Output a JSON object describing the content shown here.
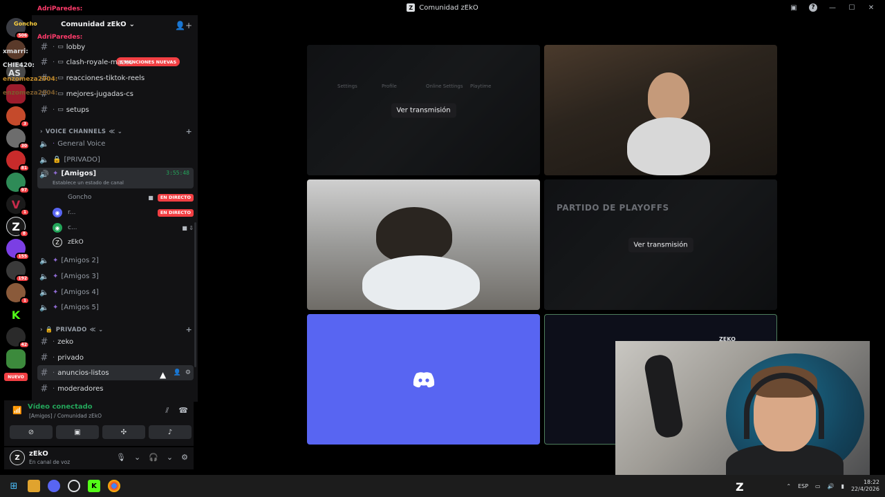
{
  "window": {
    "title": "Comunidad zEkO",
    "logo_letter": "Z"
  },
  "overlay_chat": [
    {
      "text": "AdriParedes:",
      "color": "#ff3b6b"
    },
    {
      "text": "Goncho",
      "color": "#ffd23f"
    },
    {
      "text": "AdriParedes:",
      "color": "#ff3b6b"
    },
    {
      "text": "xmarri:",
      "color": "#dbdee1"
    },
    {
      "text": "AS",
      "color": "#dbdee1"
    },
    {
      "text": "CHIE420:",
      "color": "#dbdee1"
    },
    {
      "text": "enzomeza2004:",
      "color": "#c08a2c"
    },
    {
      "text": "enzomeza2004:",
      "color": "#7a5a2c"
    }
  ],
  "server_rail": {
    "badges": [
      "506",
      "3",
      "30",
      "81",
      "97",
      "1",
      "8",
      "155",
      "192",
      "1",
      "42"
    ],
    "nuevo_label": "NUEVO"
  },
  "sidebar": {
    "server_name": "Comunidad zEkO",
    "mention_badge": "8 MENCIONES NUEVAS",
    "text_channels_top": [
      {
        "emoji": "▭",
        "name": "lobby"
      },
      {
        "emoji": "▭",
        "name": "clash-royale-mazos"
      },
      {
        "emoji": "▭",
        "name": "reacciones-tiktok-reels"
      },
      {
        "emoji": "▭",
        "name": "mejores-jugadas-cs"
      },
      {
        "emoji": "▭",
        "name": "setups"
      }
    ],
    "voice_category": "VOICE CHANNELS",
    "voice_channels_top": [
      {
        "name": "General Voice"
      },
      {
        "name": "[PRIVADO]"
      }
    ],
    "active_voice": {
      "name": "[Amigos]",
      "timer": "3:55:48",
      "status_hint": "Establece un estado de canal"
    },
    "members": [
      {
        "name": "Goncho",
        "live": "EN DIRECTO"
      },
      {
        "name": "r...",
        "live": "EN DIRECTO"
      },
      {
        "name": "c...",
        "live": ""
      },
      {
        "name": "zEkO",
        "live": ""
      }
    ],
    "voice_channels_bottom": [
      {
        "name": "[Amigos 2]"
      },
      {
        "name": "[Amigos 3]"
      },
      {
        "name": "[Amigos 4]"
      },
      {
        "name": "[Amigos 5]"
      }
    ],
    "private_category": "PRIVADO",
    "private_channels": [
      {
        "name": "zeko"
      },
      {
        "name": "privado"
      },
      {
        "name": "anuncios-listos"
      },
      {
        "name": "moderadores"
      }
    ]
  },
  "voice_panel": {
    "status": "Vídeo conectado",
    "channel": "[Amigos] / Comunidad zEkO"
  },
  "user_panel": {
    "username": "zEkO",
    "status": "En canal de voz"
  },
  "stage": {
    "watch_label": "Ver transmisión",
    "playoff_title": "PARTIDO DE PLAYOFFS",
    "menu_labels": [
      "Settings",
      "Profile",
      "Online Settings",
      "Playtime",
      "Ver transmisión"
    ],
    "webcam_label": "ZEKO"
  },
  "taskbar": {
    "lang": "ESP",
    "time": "18:22",
    "date": "22/4/2026"
  },
  "colors": {
    "accent_green": "#23a55a",
    "live_red": "#f23f43",
    "discord_blurple": "#5865f2"
  }
}
